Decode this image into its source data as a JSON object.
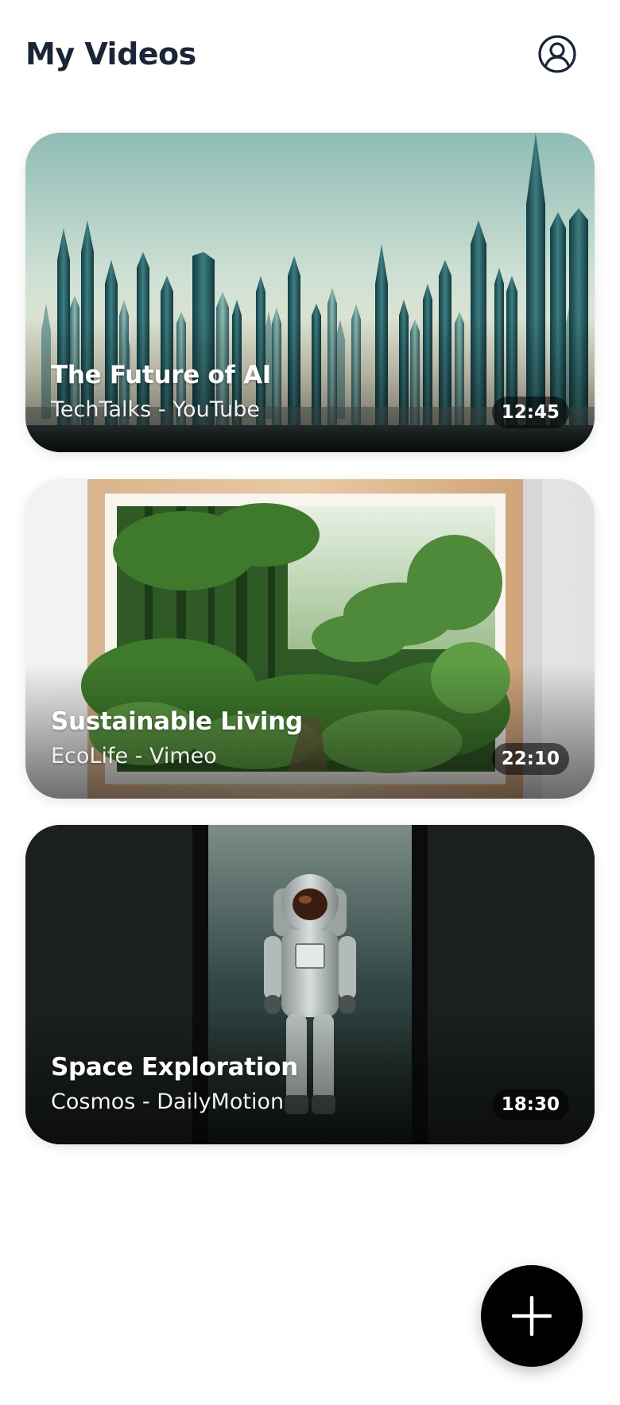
{
  "header": {
    "title": "My Videos",
    "profile_icon": "user-circle-icon"
  },
  "videos": [
    {
      "title": "The Future of AI",
      "subtitle": "TechTalks - YouTube",
      "duration": "12:45",
      "thumbnail": "futuristic-city-skyline"
    },
    {
      "title": "Sustainable Living",
      "subtitle": "EcoLife - Vimeo",
      "duration": "22:10",
      "thumbnail": "framed-forest-picture"
    },
    {
      "title": "Space Exploration",
      "subtitle": "Cosmos - DailyMotion",
      "duration": "18:30",
      "thumbnail": "astronaut-in-doorway"
    }
  ],
  "fab": {
    "icon": "plus-icon"
  },
  "colors": {
    "title": "#1b2538",
    "background": "#ffffff",
    "fab": "#000000",
    "duration_badge": "rgba(0,0,0,0.55)"
  }
}
